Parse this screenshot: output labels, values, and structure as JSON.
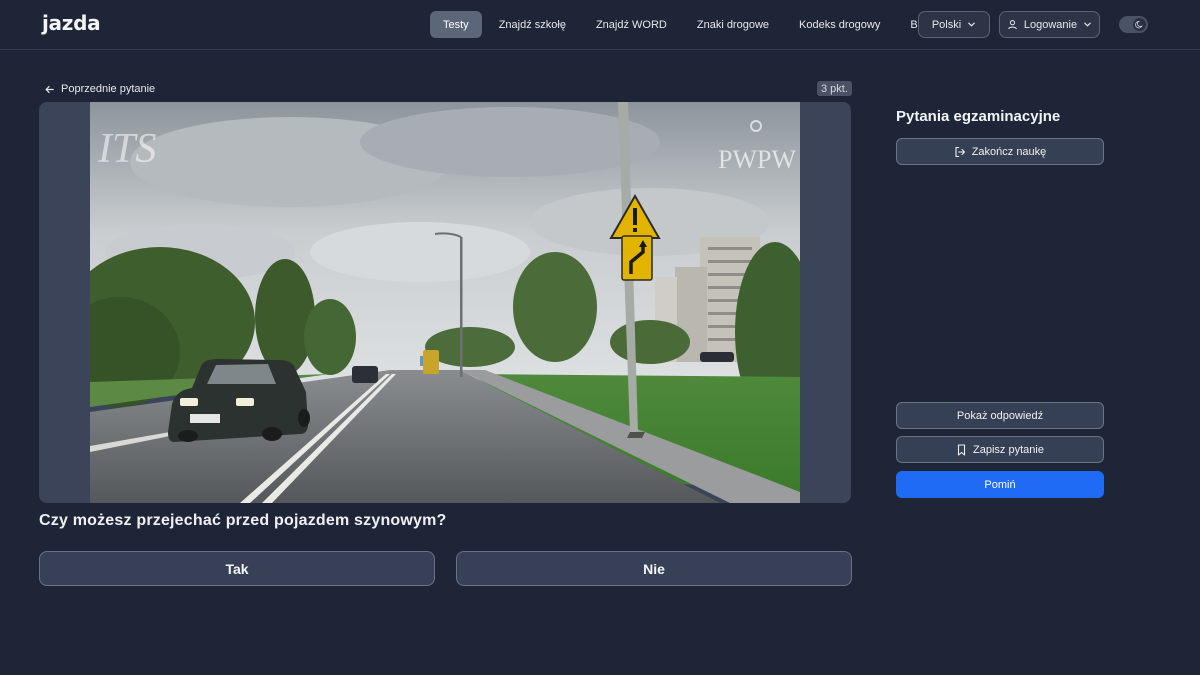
{
  "header": {
    "logo": "jazda",
    "nav": [
      {
        "label": "Testy",
        "active": true
      },
      {
        "label": "Znajdź szkołę",
        "active": false
      },
      {
        "label": "Znajdź WORD",
        "active": false
      },
      {
        "label": "Znaki drogowe",
        "active": false
      },
      {
        "label": "Kodeks drogowy",
        "active": false
      },
      {
        "label": "Blog",
        "active": false
      }
    ],
    "language": "Polski",
    "login": "Logowanie",
    "theme_toggle_icon": "moon-icon"
  },
  "question": {
    "back_label": "Poprzednie pytanie",
    "points": "3 pkt.",
    "text": "Czy możesz przejechać przed pojazdem szynowym?",
    "answers": [
      "Tak",
      "Nie"
    ],
    "watermark_left": "ITS",
    "watermark_right": "PWPW"
  },
  "side": {
    "title": "Pytania egzaminacyjne",
    "end_label": "Zakończ naukę",
    "show_answer_label": "Pokaż odpowiedź",
    "save_label": "Zapisz pytanie",
    "skip_label": "Pomiń"
  },
  "colors": {
    "background": "#1e2536",
    "accent": "#1f6bf5",
    "nav_active": "#5b6679"
  }
}
